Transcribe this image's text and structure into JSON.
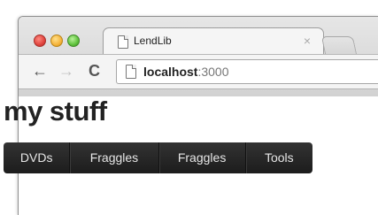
{
  "browser": {
    "tab": {
      "title": "LendLib",
      "close_glyph": "×"
    },
    "address_bar": {
      "host": "localhost",
      "port": ":3000"
    },
    "icons": [
      "back-arrow-icon",
      "forward-arrow-icon",
      "reload-icon",
      "page-icon",
      "close-icon"
    ]
  },
  "page": {
    "title": "my stuff",
    "nav": [
      "DVDs",
      "Fraggles",
      "Fraggles",
      "Tools"
    ]
  }
}
